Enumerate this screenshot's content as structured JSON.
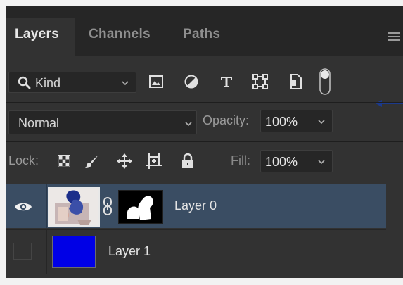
{
  "tabs": [
    {
      "label": "Layers",
      "active": true
    },
    {
      "label": "Channels",
      "active": false
    },
    {
      "label": "Paths",
      "active": false
    }
  ],
  "filter": {
    "kind_label": "Kind",
    "icons": [
      "image-filter-icon",
      "adjustment-filter-icon",
      "type-filter-icon",
      "shape-filter-icon",
      "smart-object-filter-icon",
      "filter-toggle-switch"
    ]
  },
  "blend": {
    "mode": "Normal",
    "opacity_label": "Opacity:",
    "opacity_value": "100%"
  },
  "lock": {
    "label": "Lock:",
    "icons": [
      "lock-transparent-pixels-icon",
      "lock-image-pixels-icon",
      "lock-position-icon",
      "lock-artboard-icon",
      "lock-all-icon"
    ],
    "fill_label": "Fill:",
    "fill_value": "100%"
  },
  "layers": [
    {
      "name": "Layer 0",
      "visible": true,
      "selected": true,
      "has_mask": true
    },
    {
      "name": "Layer 1",
      "visible": false,
      "selected": false,
      "swatch_color": "#0000e6"
    }
  ],
  "colors": {
    "panel_bg": "#323232",
    "tab_bar_bg": "#262626",
    "selected_row": "#3a4d63",
    "arrow_color": "#1c3a8c"
  }
}
